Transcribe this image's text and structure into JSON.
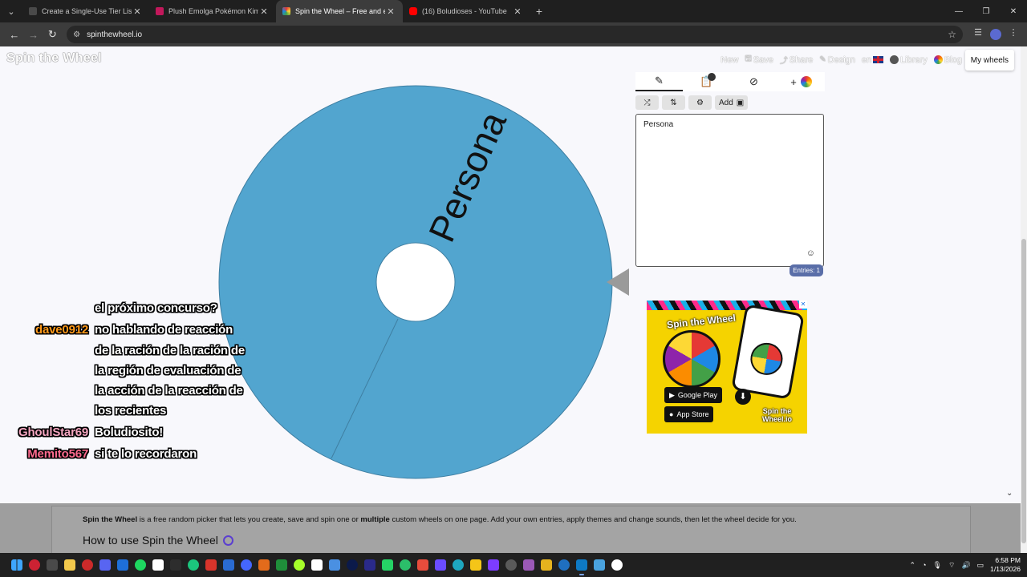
{
  "browser": {
    "tabs": [
      {
        "title": "Create a Single-Use Tier List (Pa",
        "favicon_color": "#4a4a4a",
        "active": false
      },
      {
        "title": "Plush Emolga Pokémon Kimi ni",
        "favicon_color": "#c2185b",
        "active": false
      },
      {
        "title": "Spin the Wheel – Free and easy",
        "favicon_color": "#e91e63",
        "active": true
      },
      {
        "title": "(16) Boludioses - YouTube",
        "favicon_color": "#ff0000",
        "active": false
      }
    ],
    "url": "spinthewheel.io"
  },
  "site": {
    "logo": "Spin the Wheel",
    "nav": {
      "new": "New",
      "save": "Save",
      "share": "Share",
      "design": "Design",
      "language": "en",
      "library": "Library",
      "blog": "Blog",
      "my_wheels": "My wheels"
    }
  },
  "wheel": {
    "segments": [
      {
        "label": "Persona",
        "color": "#52a5cf"
      }
    ]
  },
  "panel": {
    "tabs": [
      "edit",
      "results",
      "hide",
      "customize"
    ],
    "results_badge": "",
    "add_label": "Add",
    "entries_text": "Persona",
    "entries_count": "Entries: 1"
  },
  "chat": [
    {
      "user": "",
      "user_color": "",
      "message": "el próximo concurso?"
    },
    {
      "user": "dave0912",
      "user_color": "#ff9a1a",
      "message": "no hablando de reacción"
    },
    {
      "user": "",
      "user_color": "",
      "message": "de la ración de la ración de"
    },
    {
      "user": "",
      "user_color": "",
      "message": "la región de evaluación de"
    },
    {
      "user": "",
      "user_color": "",
      "message": "la acción de la reacción de"
    },
    {
      "user": "",
      "user_color": "",
      "message": "los recientes"
    },
    {
      "user": "GhoulStar69",
      "user_color": "#f4a6c0",
      "message": "Boludiosito!"
    },
    {
      "user": "Memito567",
      "user_color": "#ff6b8f",
      "message": "si te lo recordaron"
    }
  ],
  "ad": {
    "logo": "Spin the Wheel",
    "google_play": "Google Play",
    "app_store": "App Store",
    "brand_line1": "Spin the",
    "brand_line2": "Wheel.io"
  },
  "info": {
    "bold_name": "Spin the Wheel",
    "text_a": " is a free random picker that lets you create, save and spin one or ",
    "bold_multiple": "multiple",
    "text_b": " custom wheels on one page. Add your own entries, apply themes and change sounds, then let the wheel decide for you.",
    "heading": "How to use Spin the Wheel"
  },
  "taskbar": {
    "time": "6:58 PM",
    "date": "1/13/2026",
    "app_colors": [
      "#cc2233",
      "#4a4a4a",
      "#f2c94c",
      "#cc2a2a",
      "#5865f2",
      "#1e6fd9",
      "#1ed760",
      "#ffffff",
      "#2d2d2d",
      "#1bc47d",
      "#d9342b",
      "#2a6bd1",
      "#4466ff",
      "#e36b1b",
      "#1f8f3a",
      "#a6ff2a",
      "#ffffff",
      "#4a90e2",
      "#0b1a4a",
      "#2a2a8a",
      "#25d366",
      "#2bbf6a",
      "#e74c3c",
      "#6a4cff",
      "#1ea7c0",
      "#f5c518",
      "#7d3cff",
      "#5a5a5a",
      "#9b59b6",
      "#e6b31e",
      "#1f6fc0",
      "#0e7ac4",
      "#4aa3df",
      "#ffffff"
    ]
  }
}
